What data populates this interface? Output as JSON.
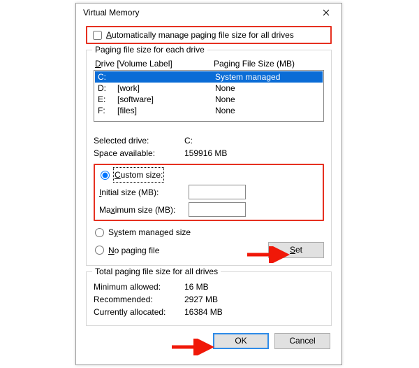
{
  "window": {
    "title": "Virtual Memory"
  },
  "auto_manage": {
    "label_pre": "A",
    "label_rest": "utomatically manage paging file size for all drives",
    "checked": false
  },
  "drives_group": {
    "legend": "Paging file size for each drive",
    "header_drive_u": "D",
    "header_drive_rest": "rive  [Volume Label]",
    "header_size": "Paging File Size (MB)",
    "rows": [
      {
        "letter": "C:",
        "label": "",
        "size": "System managed",
        "selected": true
      },
      {
        "letter": "D:",
        "label": "[work]",
        "size": "None",
        "selected": false
      },
      {
        "letter": "E:",
        "label": "[software]",
        "size": "None",
        "selected": false
      },
      {
        "letter": "F:",
        "label": "[files]",
        "size": "None",
        "selected": false
      }
    ],
    "selected_drive_label": "Selected drive:",
    "selected_drive_value": "C:",
    "space_label": "Space available:",
    "space_value": "159916 MB",
    "custom_u": "C",
    "custom_rest": "ustom size:",
    "initial_u": "I",
    "initial_rest": "nitial size (MB):",
    "initial_value": "",
    "max_u": "M",
    "max_rest_a": "a",
    "max_rest_b": "ximum size (MB):",
    "max_value": "",
    "sysman_u": "y",
    "sysman_pre": "S",
    "sysman_rest": "stem managed size",
    "nopage_u": "N",
    "nopage_rest": "o paging file",
    "set_u": "S",
    "set_rest": "et",
    "radio_value": "custom"
  },
  "totals_group": {
    "legend": "Total paging file size for all drives",
    "min_label": "Minimum allowed:",
    "min_value": "16 MB",
    "rec_label": "Recommended:",
    "rec_value": "2927 MB",
    "cur_label": "Currently allocated:",
    "cur_value": "16384 MB"
  },
  "buttons": {
    "ok": "OK",
    "cancel": "Cancel"
  }
}
